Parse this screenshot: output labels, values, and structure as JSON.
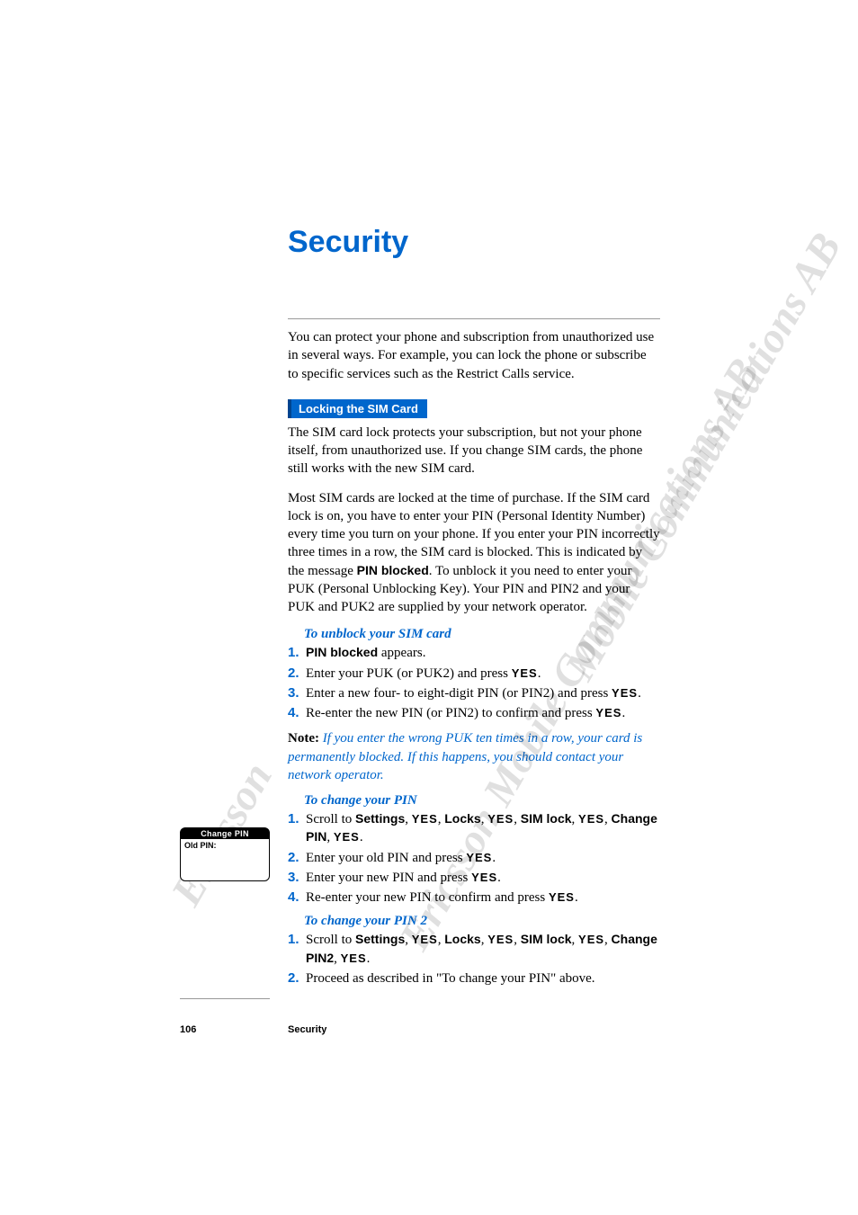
{
  "page": {
    "title": "Security",
    "footer_title": "Security",
    "page_number": "106"
  },
  "watermark": {
    "line1": "Ericsson Mobile Communications AB",
    "line2": "Mobile Communications AB",
    "line3": "Ericsson"
  },
  "intro": "You can protect your phone and subscription from unauthorized use in several ways. For example, you can lock the phone or subscribe to specific services such as the Restrict Calls service.",
  "section1": {
    "heading": "Locking the SIM Card",
    "para1": "The SIM card lock protects your subscription, but not your phone itself, from unauthorized use. If you change SIM cards, the phone still works with the new SIM card.",
    "para2_pre": "Most SIM cards are locked at the time of purchase. If the SIM card lock is on, you have to enter your PIN (Personal Identity Number) every time you turn on your phone. If you enter your PIN incorrectly three times in a row, the SIM card is blocked. This is indicated by the message ",
    "para2_bold": "PIN blocked",
    "para2_post": ". To unblock it you need to enter your PUK (Personal Unblocking Key). Your PIN and PIN2 and your PUK and PUK2 are supplied by your network operator."
  },
  "unblock": {
    "heading": "To unblock your SIM card",
    "s1_bold": "PIN blocked",
    "s1_post": " appears.",
    "s2_pre": "Enter your PUK (or PUK2) and press ",
    "s3_pre": "Enter a new four- to eight-digit PIN (or PIN2) and press ",
    "s4_pre": "Re-enter the new PIN (or PIN2) to confirm and press "
  },
  "yes": "YES",
  "period": ".",
  "comma": ", ",
  "note": {
    "label": "Note:",
    "text": " If you enter the wrong PUK ten times in a row, your card is permanently blocked. If this happens, you should contact your network operator."
  },
  "change_pin": {
    "heading": "To change your PIN",
    "s1_scroll": "Scroll to ",
    "settings": "Settings",
    "locks": "Locks",
    "simlock": "SIM lock",
    "changepin": "Change PIN",
    "s2": "Enter your old PIN and press ",
    "s3": "Enter your new PIN and press ",
    "s4": "Re-enter your new PIN to confirm and press "
  },
  "phone_screen": {
    "title": "Change PIN",
    "body": "Old PIN:"
  },
  "change_pin2": {
    "heading": "To change your PIN 2",
    "changepin2": "Change PIN2",
    "s2": "Proceed as described in \"To change your PIN\" above."
  },
  "nums": {
    "n1": "1.",
    "n2": "2.",
    "n3": "3.",
    "n4": "4."
  }
}
